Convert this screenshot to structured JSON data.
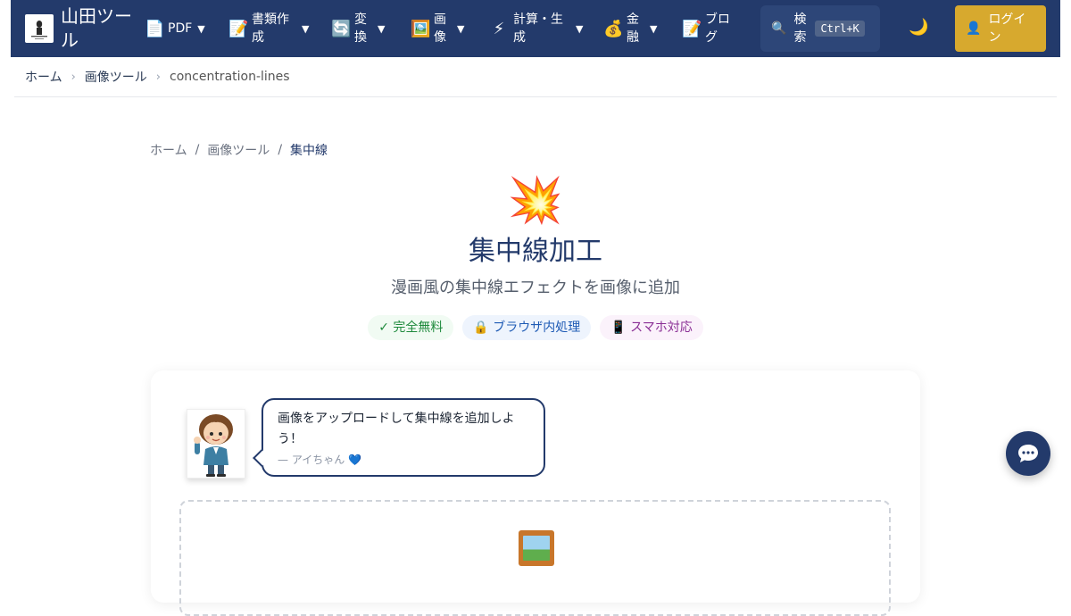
{
  "navbar": {
    "site_name": "山田ツール",
    "items": [
      {
        "icon": "📄",
        "label": "PDF",
        "caret": "▼"
      },
      {
        "icon": "📝",
        "label": "書類作成",
        "caret": "▼"
      },
      {
        "icon": "🔄",
        "label": "変換",
        "caret": "▼"
      },
      {
        "icon": "🖼️",
        "label": "画像",
        "caret": "▼"
      },
      {
        "icon": "⚡",
        "label": "計算・生成",
        "caret": "▼"
      },
      {
        "icon": "💰",
        "label": "金融",
        "caret": "▼"
      },
      {
        "icon": "📝",
        "label": "ブログ"
      }
    ],
    "search": {
      "icon": "🔍",
      "label": "検索",
      "shortcut": "Ctrl+K"
    },
    "theme_toggle_icon": "🌙",
    "login": {
      "icon": "👤",
      "label": "ログイン"
    }
  },
  "breadcrumb_top": [
    "ホーム",
    "画像ツール",
    "concentration-lines"
  ],
  "breadcrumb_inner": [
    "ホーム",
    "画像ツール",
    "集中線"
  ],
  "hero": {
    "icon": "💥",
    "title": "集中線加工",
    "subtitle": "漫画風の集中線エフェクトを画像に追加"
  },
  "badges": [
    {
      "text": "✓ 完全無料",
      "kind": "free"
    },
    {
      "text": "🔒 ブラウザ内処理",
      "kind": "browser"
    },
    {
      "text": "📱 スマホ対応",
      "kind": "mobile"
    }
  ],
  "assistant": {
    "message": "画像をアップロードして集中線を追加しよう！",
    "signature": "— アイちゃん 💙"
  },
  "dropzone": {
    "icon": "image-frame-icon"
  },
  "chat_button": {
    "icon": "💬"
  },
  "colors": {
    "navbar": "#233a6b",
    "login": "#d7a92e",
    "accent": "#233a6b"
  }
}
